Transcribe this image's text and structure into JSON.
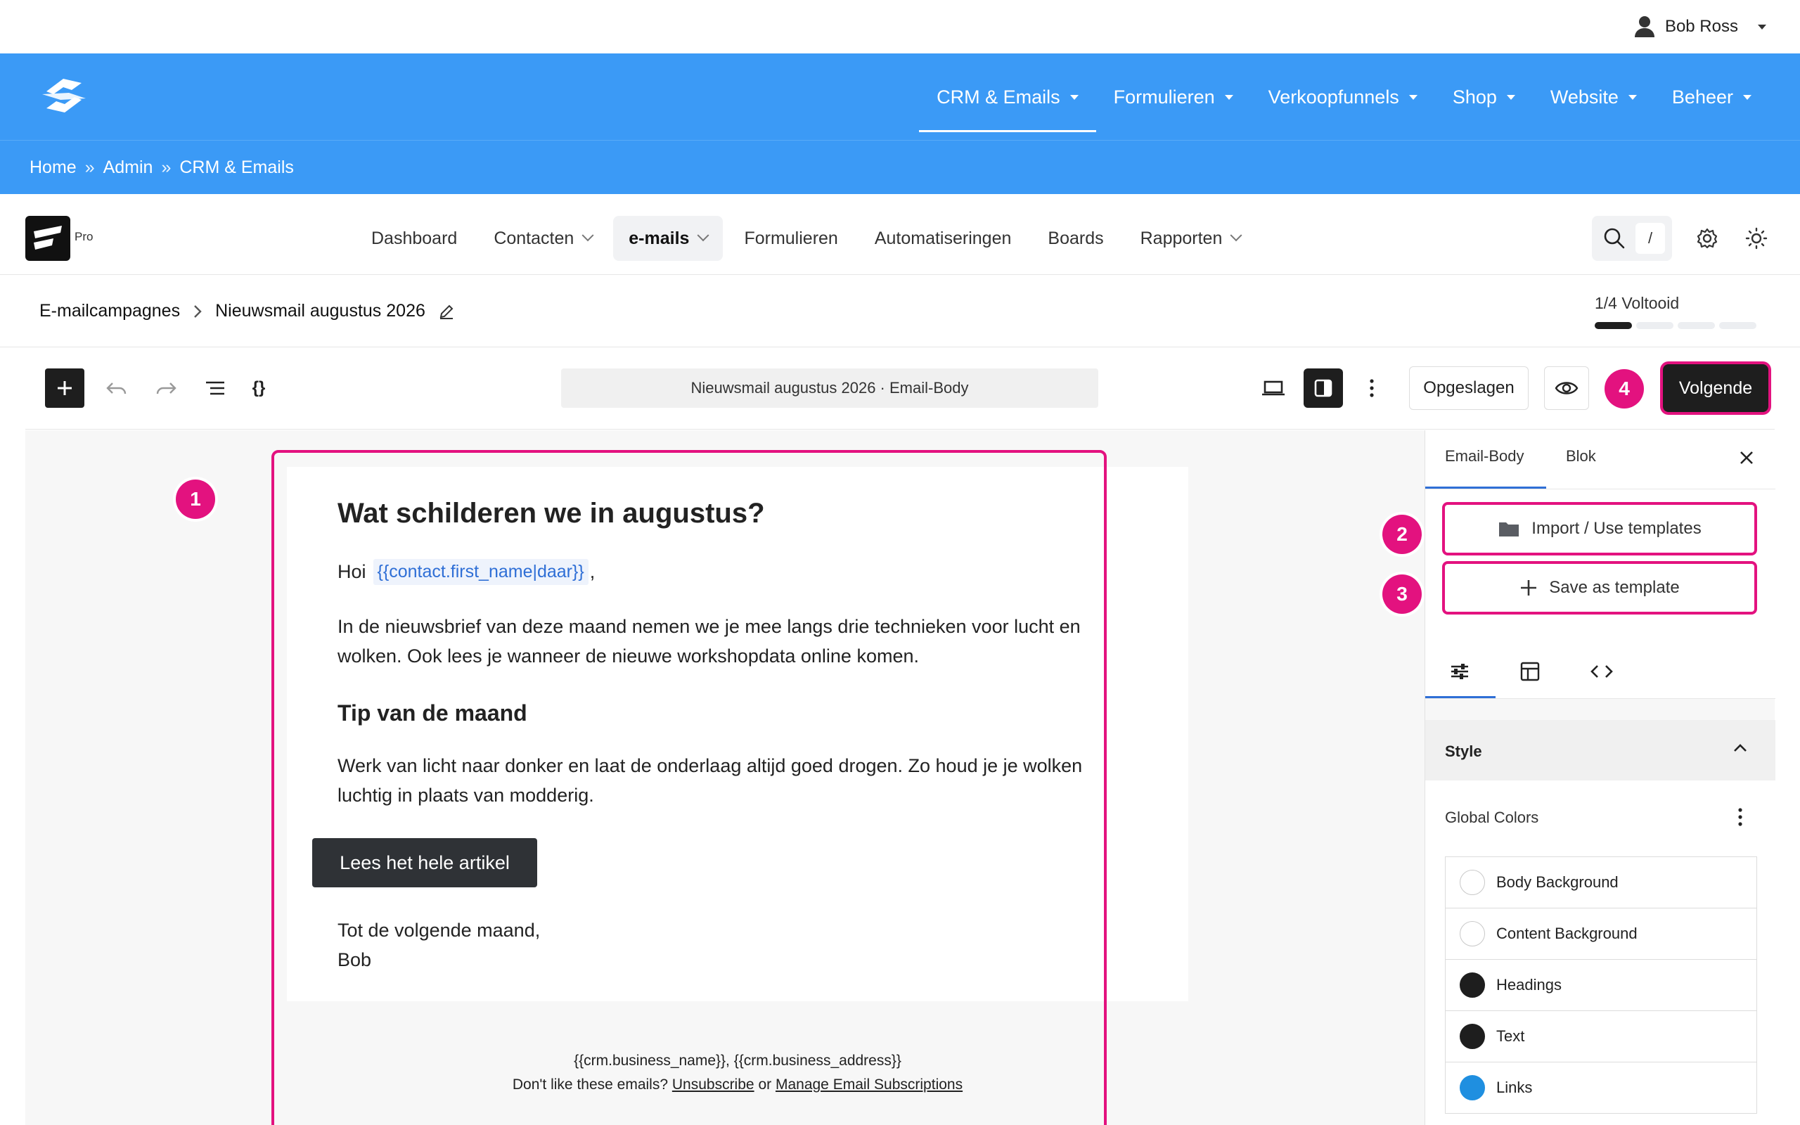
{
  "user": {
    "name": "Bob Ross"
  },
  "main_nav": [
    {
      "label": "CRM & Emails"
    },
    {
      "label": "Formulieren"
    },
    {
      "label": "Verkoopfunnels"
    },
    {
      "label": "Shop"
    },
    {
      "label": "Website"
    },
    {
      "label": "Beheer"
    }
  ],
  "breadcrumb": {
    "items": [
      "Home",
      "Admin",
      "CRM & Emails"
    ],
    "separator": "»"
  },
  "app": {
    "badge": "Pro",
    "nav": [
      {
        "label": "Dashboard"
      },
      {
        "label": "Contacten"
      },
      {
        "label": "e-mails"
      },
      {
        "label": "Formulieren"
      },
      {
        "label": "Automatiseringen"
      },
      {
        "label": "Boards"
      },
      {
        "label": "Rapporten"
      }
    ],
    "search_shortcut": "/"
  },
  "campaign": {
    "parent": "E-mailcampagnes",
    "name": "Nieuwsmail augustus 2026",
    "progress_label": "1/4 Voltooid",
    "steps_done": 1,
    "steps_total": 4
  },
  "toolbar": {
    "doc_title": "Nieuwsmail augustus 2026 · Email-Body",
    "saved_label": "Opgeslagen",
    "next_label": "Volgende"
  },
  "email": {
    "title": "Wat schilderen we in augustus?",
    "greeting": "Hoi",
    "merge_tag": "{{contact.first_name|daar}}",
    "greeting_suffix": ",",
    "paragraph1": "In de nieuwsbrief van deze maand nemen we je mee langs drie technieken voor lucht en wolken. Ook lees je wanneer de nieuwe workshopdata online komen.",
    "heading2": "Tip van de maand",
    "paragraph2": "Werk van licht naar donker en laat de onderlaag altijd goed drogen. Zo houd je je wolken luchtig in plaats van modderig.",
    "button_label": "Lees het hele artikel",
    "signoff_line1": "Tot de volgende maand,",
    "signoff_line2": "Bob",
    "footer_line1": "{{crm.business_name}}, {{crm.business_address}}",
    "footer_question": "Don't like these emails?",
    "footer_unsubscribe": "Unsubscribe",
    "footer_or": "or",
    "footer_manage": "Manage Email Subscriptions"
  },
  "markers": [
    "1",
    "2",
    "3",
    "4"
  ],
  "panel": {
    "tabs": [
      {
        "label": "Email-Body"
      },
      {
        "label": "Blok"
      }
    ],
    "import_label": "Import / Use templates",
    "save_template_label": "Save as template",
    "style_title": "Style",
    "global_colors_label": "Global Colors",
    "colors": [
      {
        "name": "Body Background",
        "color": "#ffffff"
      },
      {
        "name": "Content Background",
        "color": "#ffffff"
      },
      {
        "name": "Headings",
        "color": "#1e1e1e"
      },
      {
        "name": "Text",
        "color": "#1e1e1e"
      },
      {
        "name": "Links",
        "color": "#1f8fe0"
      }
    ]
  },
  "colors": {
    "brand_blue": "#3b9af6",
    "highlight": "#e3127f",
    "dark": "#1e1e1e",
    "link_blue": "#2f6fd6"
  }
}
